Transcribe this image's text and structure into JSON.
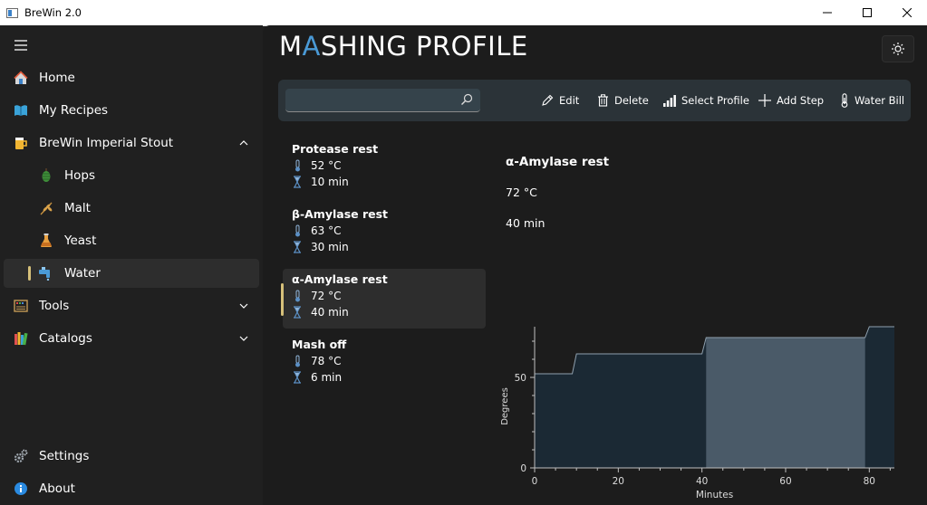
{
  "window": {
    "title": "BreWin 2.0"
  },
  "sidebar": {
    "home": "Home",
    "my_recipes": "My Recipes",
    "recipe": "BreWin Imperial Stout",
    "hops": "Hops",
    "malt": "Malt",
    "yeast": "Yeast",
    "water": "Water",
    "tools": "Tools",
    "catalogs": "Catalogs",
    "settings": "Settings",
    "about": "About"
  },
  "page": {
    "title": "MASHING PROFILE"
  },
  "search": {
    "placeholder": "",
    "value": ""
  },
  "toolbar": {
    "edit": "Edit",
    "delete": "Delete",
    "select_profile": "Select Profile",
    "add_step": "Add Step",
    "water_bill": "Water Bill"
  },
  "steps": [
    {
      "name": "Protease rest",
      "temp": "52 °C",
      "time": "10 min"
    },
    {
      "name": "β-Amylase rest",
      "temp": "63 °C",
      "time": "30 min"
    },
    {
      "name": "α-Amylase rest",
      "temp": "72 °C",
      "time": "40 min"
    },
    {
      "name": "Mash off",
      "temp": "78 °C",
      "time": "6 min"
    }
  ],
  "detail": {
    "name": "α-Amylase rest",
    "temp": "72 °C",
    "time": "40 min"
  },
  "colors": {
    "accent": "#d6c07a",
    "chart_fill": "#1b2934",
    "chart_highlight": "#4a5a68",
    "chart_line": "#8fa0ae"
  },
  "chart_data": {
    "type": "area",
    "xlabel": "Minutes",
    "ylabel": "Degrees",
    "xlim": [
      0,
      86
    ],
    "ylim": [
      0,
      78
    ],
    "xticks": [
      0,
      20,
      40,
      60,
      80
    ],
    "yticks": [
      0,
      50
    ],
    "x": [
      0,
      9,
      10,
      40,
      41,
      79,
      80,
      86
    ],
    "y": [
      52,
      52,
      63,
      63,
      72,
      72,
      78,
      78
    ],
    "highlight_range": [
      41,
      79
    ]
  }
}
